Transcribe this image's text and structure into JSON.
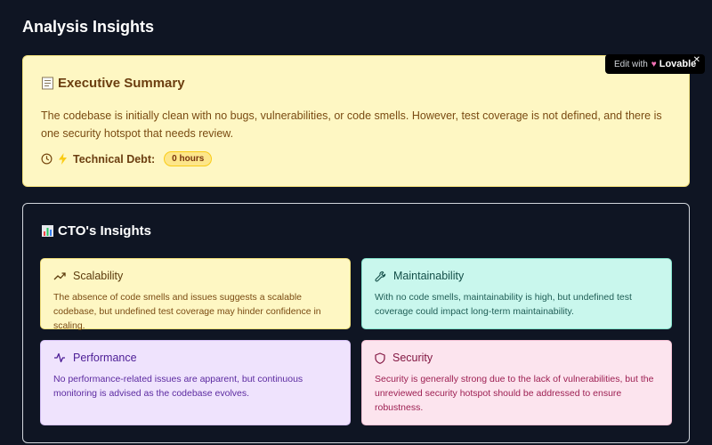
{
  "page": {
    "title": "Analysis Insights"
  },
  "summary": {
    "icon": "memo-icon",
    "title": "Executive Summary",
    "text": "The codebase is initially clean with no bugs, vulnerabilities, or code smells. However, test coverage is not defined, and there is one security hotspot that needs review.",
    "debt_label": "Technical Debt:",
    "debt_value": "0 hours"
  },
  "lovable": {
    "prefix": "Edit with",
    "brand": "Lovable"
  },
  "cto": {
    "icon": "bar-chart-icon",
    "title": "CTO's Insights",
    "cards": [
      {
        "title": "Scalability",
        "icon": "trending-up-icon",
        "text": "The absence of code smells and issues suggests a scalable codebase, but undefined test coverage may hinder confidence in scaling."
      },
      {
        "title": "Maintainability",
        "icon": "wrench-icon",
        "text": "With no code smells, maintainability is high, but undefined test coverage could impact long-term maintainability."
      },
      {
        "title": "Performance",
        "icon": "activity-icon",
        "text": "No performance-related issues are apparent, but continuous monitoring is advised as the codebase evolves."
      },
      {
        "title": "Security",
        "icon": "shield-icon",
        "text": "Security is generally strong due to the lack of vulnerabilities, but the unreviewed security hotspot should be addressed to ensure robustness."
      }
    ]
  },
  "colors": {
    "background": "#0f1523",
    "summary_bg": "#fef7c3",
    "maintainability_bg": "#c9f7ed",
    "performance_bg": "#efe3fd",
    "security_bg": "#fce4ee"
  }
}
